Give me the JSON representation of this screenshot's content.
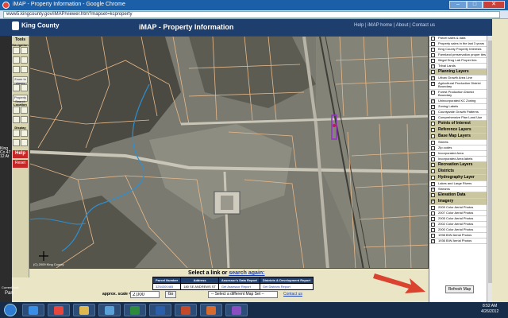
{
  "window": {
    "title": "iMAP - Property Information - Google Chrome",
    "url": "www5.kingcounty.gov/iMAP/viewer.htm?mapset=kcproperty",
    "minimize_label": "–",
    "maximize_label": "□",
    "close_label": "✕"
  },
  "header": {
    "logo_text": "King County",
    "app_title": "iMAP - Property Information",
    "help_text": "Help | iMAP home | About | Contact us"
  },
  "left_panel": {
    "text": "King Co 47 12 At"
  },
  "tools": {
    "tools_label": "Tools",
    "navigation_label": "Navigation",
    "zoom_label": "Zoom to places",
    "property_label": "Property Search",
    "location_label": "Location",
    "display_label": "Display",
    "help_label": "Help",
    "reset_label": "Reset"
  },
  "map": {
    "copyright": "(C) 2009 King County"
  },
  "results": {
    "prompt_prefix": "Select a link or",
    "prompt_link": "search again:",
    "headers": [
      "Parcel Number",
      "Address",
      "Assessor's Data Report",
      "Districts & Development Report"
    ],
    "row": [
      "3254300465",
      "180 SE ANDREWS ST",
      "Get Assessor Report",
      "Get Districts Report"
    ]
  },
  "controls": {
    "scale_label": "approx. scale = 1:",
    "scale_value": "2,000",
    "go_label": "Go",
    "mapset_label": "-- Select a different Map Set --",
    "contact_label": "Contact us"
  },
  "current_tool": {
    "label": "Current tool:",
    "value": "Pan"
  },
  "layers": [
    {
      "label": "Parcel sales & data",
      "type": "item",
      "checked": false
    },
    {
      "label": "Property sales in the last 3 years",
      "type": "item",
      "checked": false
    },
    {
      "label": "King County Property Interests",
      "type": "item",
      "checked": false
    },
    {
      "label": "Farmland preservation proper ties",
      "type": "item",
      "checked": false
    },
    {
      "label": "Illegal Drug Lab Proper ties",
      "type": "item",
      "checked": false
    },
    {
      "label": "Tribal Lands",
      "type": "item",
      "checked": true
    },
    {
      "label": "Planning Layers",
      "type": "group",
      "checked": false
    },
    {
      "label": "Urban Growth Area Line",
      "type": "item",
      "checked": true
    },
    {
      "label": "Agricultural Production District Boundary",
      "type": "item",
      "checked": true
    },
    {
      "label": "Forest Production District Boundary",
      "type": "item",
      "checked": false
    },
    {
      "label": "Unincorporated KC Zoning",
      "type": "item",
      "checked": true
    },
    {
      "label": "Zoning Labels",
      "type": "item",
      "checked": true
    },
    {
      "label": "Countywide Growth Patterns",
      "type": "item",
      "checked": false
    },
    {
      "label": "Comprehensive Plan Land Use",
      "type": "item",
      "checked": false
    },
    {
      "label": "Points of Interest",
      "type": "group",
      "checked": false
    },
    {
      "label": "Reference Layers",
      "type": "group",
      "checked": false
    },
    {
      "label": "Base Map Layers",
      "type": "group",
      "checked": false
    },
    {
      "label": "Streets",
      "type": "item",
      "checked": false
    },
    {
      "label": "Zip codes",
      "type": "item",
      "checked": false
    },
    {
      "label": "Incorporated Area",
      "type": "item",
      "checked": false
    },
    {
      "label": "Incorporated Area labels",
      "type": "item",
      "checked": false
    },
    {
      "label": "Recreation Layers",
      "type": "group",
      "checked": false
    },
    {
      "label": "Districts",
      "type": "group",
      "checked": false
    },
    {
      "label": "Hydrography Layer",
      "type": "group",
      "checked": false
    },
    {
      "label": "Lakes and Large Rivers",
      "type": "item",
      "checked": true
    },
    {
      "label": "Streams",
      "type": "item",
      "checked": true
    },
    {
      "label": "Elevation Data",
      "type": "group",
      "checked": false
    },
    {
      "label": "Imagery",
      "type": "group",
      "checked": true
    },
    {
      "label": "2009 Color Aerial Photos",
      "type": "item",
      "checked": false
    },
    {
      "label": "2007 Color Aerial Photos",
      "type": "item",
      "checked": false
    },
    {
      "label": "2005 Color Aerial Photos",
      "type": "item",
      "checked": false
    },
    {
      "label": "2002 Color Aerial Photos",
      "type": "item",
      "checked": false
    },
    {
      "label": "2000 Color Aerial Photos",
      "type": "item",
      "checked": false
    },
    {
      "label": "1998 B/W Aerial Photos",
      "type": "item",
      "checked": false
    },
    {
      "label": "1936 B/W Aerial Photos",
      "type": "item",
      "checked": true
    }
  ],
  "refresh_label": "Refresh Map",
  "clock": {
    "time": "8:52 AM",
    "date": "4/26/2012"
  },
  "colors": {
    "header": "#1e3e6e",
    "parcel_line": "#e8b98a",
    "stream": "#2e8fd0",
    "highlight": "#9a2cd0",
    "arrow": "#d9432f"
  }
}
